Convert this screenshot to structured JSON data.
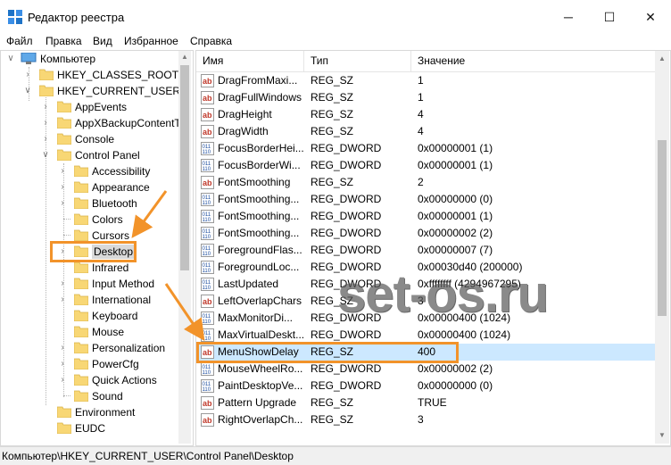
{
  "window": {
    "title": "Редактор реестра",
    "controls": {
      "minimize": "─",
      "maximize": "☐",
      "close": "✕"
    }
  },
  "menu": [
    "Файл",
    "Правка",
    "Вид",
    "Избранное",
    "Справка"
  ],
  "tree": {
    "root": "Компьютер",
    "hives": [
      "HKEY_CLASSES_ROOT",
      "HKEY_CURRENT_USER"
    ],
    "hkcu_children": [
      "AppEvents",
      "AppXBackupContentT",
      "Console",
      "Control Panel"
    ],
    "control_panel_children": [
      "Accessibility",
      "Appearance",
      "Bluetooth",
      "Colors",
      "Cursors",
      "Desktop",
      "Infrared",
      "Input Method",
      "International",
      "Keyboard",
      "Mouse",
      "Personalization",
      "PowerCfg",
      "Quick Actions",
      "Sound"
    ],
    "after": [
      "Environment",
      "EUDC"
    ],
    "selected": "Desktop"
  },
  "columns": [
    "Имя",
    "Тип",
    "Значение"
  ],
  "values": [
    {
      "name": "DragFromMaxi...",
      "type": "REG_SZ",
      "data": "1",
      "icon": "string-value-icon"
    },
    {
      "name": "DragFullWindows",
      "type": "REG_SZ",
      "data": "1",
      "icon": "string-value-icon"
    },
    {
      "name": "DragHeight",
      "type": "REG_SZ",
      "data": "4",
      "icon": "string-value-icon"
    },
    {
      "name": "DragWidth",
      "type": "REG_SZ",
      "data": "4",
      "icon": "string-value-icon"
    },
    {
      "name": "FocusBorderHei...",
      "type": "REG_DWORD",
      "data": "0x00000001 (1)",
      "icon": "binary-value-icon"
    },
    {
      "name": "FocusBorderWi...",
      "type": "REG_DWORD",
      "data": "0x00000001 (1)",
      "icon": "binary-value-icon"
    },
    {
      "name": "FontSmoothing",
      "type": "REG_SZ",
      "data": "2",
      "icon": "string-value-icon"
    },
    {
      "name": "FontSmoothing...",
      "type": "REG_DWORD",
      "data": "0x00000000 (0)",
      "icon": "binary-value-icon"
    },
    {
      "name": "FontSmoothing...",
      "type": "REG_DWORD",
      "data": "0x00000001 (1)",
      "icon": "binary-value-icon"
    },
    {
      "name": "FontSmoothing...",
      "type": "REG_DWORD",
      "data": "0x00000002 (2)",
      "icon": "binary-value-icon"
    },
    {
      "name": "ForegroundFlas...",
      "type": "REG_DWORD",
      "data": "0x00000007 (7)",
      "icon": "binary-value-icon"
    },
    {
      "name": "ForegroundLoc...",
      "type": "REG_DWORD",
      "data": "0x00030d40 (200000)",
      "icon": "binary-value-icon"
    },
    {
      "name": "LastUpdated",
      "type": "REG_DWORD",
      "data": "0xffffffff (4294967295)",
      "icon": "binary-value-icon"
    },
    {
      "name": "LeftOverlapChars",
      "type": "REG_SZ",
      "data": "3",
      "icon": "string-value-icon"
    },
    {
      "name": "MaxMonitorDi...",
      "type": "REG_DWORD",
      "data": "0x00000400 (1024)",
      "icon": "binary-value-icon"
    },
    {
      "name": "MaxVirtualDeskt...",
      "type": "REG_DWORD",
      "data": "0x00000400 (1024)",
      "icon": "binary-value-icon"
    },
    {
      "name": "MenuShowDelay",
      "type": "REG_SZ",
      "data": "400",
      "icon": "string-value-icon",
      "selected": true
    },
    {
      "name": "MouseWheelRo...",
      "type": "REG_DWORD",
      "data": "0x00000002 (2)",
      "icon": "binary-value-icon"
    },
    {
      "name": "PaintDesktopVe...",
      "type": "REG_DWORD",
      "data": "0x00000000 (0)",
      "icon": "binary-value-icon"
    },
    {
      "name": "Pattern Upgrade",
      "type": "REG_SZ",
      "data": "TRUE",
      "icon": "string-value-icon"
    },
    {
      "name": "RightOverlapCh...",
      "type": "REG_SZ",
      "data": "3",
      "icon": "string-value-icon"
    }
  ],
  "status": "Компьютер\\HKEY_CURRENT_USER\\Control Panel\\Desktop",
  "watermark": "set-os.ru",
  "colors": {
    "accent_orange": "#f2932a",
    "selection": "#cce8ff",
    "folder": "#f8d775"
  }
}
